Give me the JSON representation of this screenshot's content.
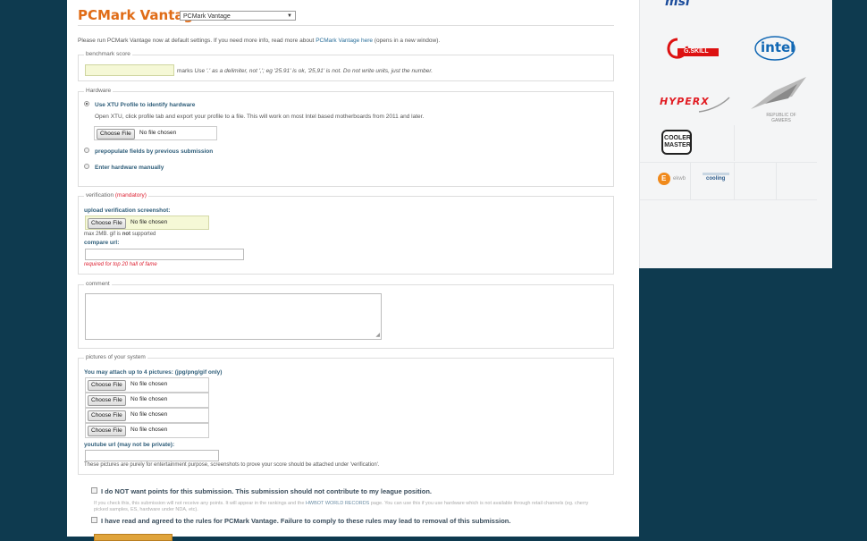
{
  "header": {
    "title": "PCMark Vantage",
    "select_value": "PCMark Vantage"
  },
  "intro": {
    "text": "Please run PCMark Vantage now at default settings. If you need more info, read more about",
    "link": "PCMark Vantage here",
    "suffix": "(opens in a new window)."
  },
  "benchmark": {
    "legend": "benchmark score",
    "unit": "marks",
    "hint": "Use '.' as a delimiter, not ','; eg '25.91' is ok, '25,91' is not. Do not write units, just the number."
  },
  "hardware": {
    "legend": "Hardware",
    "options": [
      {
        "label": "Use XTU Profile to identify hardware"
      },
      {
        "label": "prepopulate fields by previous submission"
      },
      {
        "label": "Enter hardware manually"
      }
    ],
    "xtu_desc": "Open XTU, click profile tab and export your profile to a file. This will work on most Intel based motherboards from 2011 and later."
  },
  "file_input": {
    "button": "Choose File",
    "status": "No file chosen"
  },
  "verification": {
    "legend": "verification",
    "mandatory": "(mandatory)",
    "upload_label": "upload verification screenshot:",
    "max_prefix": "max 2MB. gif is",
    "max_bold": "not",
    "max_suffix": "supported",
    "compare_label": "compare url:",
    "required_note": "required for top 20 hall of fame"
  },
  "comment": {
    "legend": "comment"
  },
  "pictures": {
    "legend": "pictures of your system",
    "attach_label": "You may attach up to 4 pictures: (jpg/png/gif only)",
    "youtube_label": "youtube url (may not be private):",
    "note": "These pictures are purely for entertainment purpose, screenshots to prove your score should be attached under 'verification'."
  },
  "agreements": {
    "no_points": "I do NOT want points for this submission. This submission should not contribute to my league position.",
    "no_points_fine_a": "If you check this, this submission will not receive any points. It will appear in the rankings and the",
    "no_points_fine_link": "HWBOT WORLD RECORDS",
    "no_points_fine_b": "page. You can use this if you use hardware which is not available through retail channels (eg. cherry picked samples, ES, hardware under NDA, etc).",
    "rules": "I have read and agreed to the rules for PCMark Vantage. Failure to comply to these rules may lead to removal of this submission."
  },
  "sponsors": {
    "gskill": "G.SKILL",
    "intel": "intel",
    "hyperx": "HYPERX",
    "rog_line1": "REPUBLIC OF",
    "rog_line2": "GAMERS",
    "cooler_line1": "COOLER",
    "cooler_line2": "MASTER",
    "ekwb": "ekwb",
    "phanteks": "cooling",
    "msi": "msi"
  },
  "colors": {
    "accent": "#e06c17",
    "link": "#2a6f9a",
    "label": "#2f5e7a",
    "background": "#0e3a4f",
    "required": "#dd2233"
  }
}
